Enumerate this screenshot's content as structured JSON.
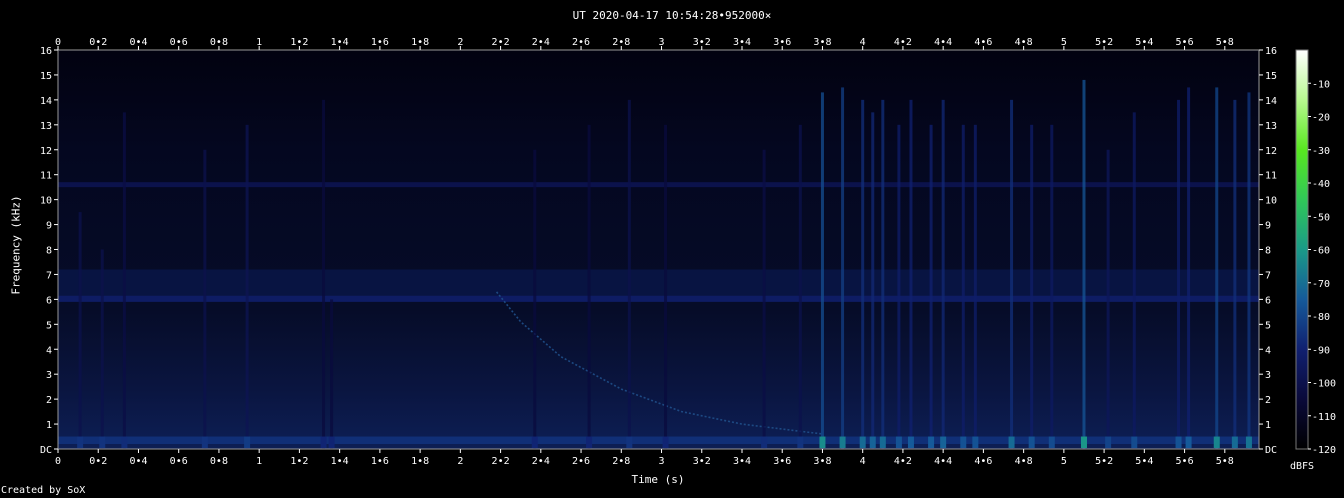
{
  "chart_data": {
    "type": "heatmap",
    "title": "UT 2020-04-17 10:54:28•952000×",
    "xlabel": "Time (s)",
    "ylabel": "Frequency (kHz)",
    "x_range": [
      0,
      5.97
    ],
    "y_range": [
      0,
      16
    ],
    "x_ticks": [
      "0",
      "0•2",
      "0•4",
      "0•6",
      "0•8",
      "1",
      "1•2",
      "1•4",
      "1•6",
      "1•8",
      "2",
      "2•2",
      "2•4",
      "2•6",
      "2•8",
      "3",
      "3•2",
      "3•4",
      "3•6",
      "3•8",
      "4",
      "4•2",
      "4•4",
      "4•6",
      "4•8",
      "5",
      "5•2",
      "5•4",
      "5•6",
      "5•8"
    ],
    "x_tick_values": [
      0,
      0.2,
      0.4,
      0.6,
      0.8,
      1,
      1.2,
      1.4,
      1.6,
      1.8,
      2,
      2.2,
      2.4,
      2.6,
      2.8,
      3,
      3.2,
      3.4,
      3.6,
      3.8,
      4,
      4.2,
      4.4,
      4.6,
      4.8,
      5,
      5.2,
      5.4,
      5.6,
      5.8
    ],
    "y_ticks": [
      "DC",
      "1",
      "2",
      "3",
      "4",
      "5",
      "6",
      "7",
      "8",
      "9",
      "10",
      "11",
      "12",
      "13",
      "14",
      "15",
      "16"
    ],
    "y_tick_values": [
      0,
      1,
      2,
      3,
      4,
      5,
      6,
      7,
      8,
      9,
      10,
      11,
      12,
      13,
      14,
      15,
      16
    ],
    "colorbar": {
      "label": "dBFS",
      "ticks": [
        "-10",
        "-20",
        "-30",
        "-40",
        "-50",
        "-60",
        "-70",
        "-80",
        "-90",
        "-100",
        "-110",
        "-120"
      ],
      "tick_values": [
        -10,
        -20,
        -30,
        -40,
        -50,
        -60,
        -70,
        -80,
        -90,
        -100,
        -110,
        -120
      ],
      "range": [
        -120,
        0
      ],
      "colors": [
        "#000000",
        "#0a0a3a",
        "#102070",
        "#155a9a",
        "#1a9a88",
        "#30c858",
        "#58e820",
        "#b8f890",
        "#ffffff"
      ]
    },
    "bands": [
      {
        "freq_from": 0.2,
        "freq_to": 0.5,
        "level": -85
      },
      {
        "freq_from": 5.9,
        "freq_to": 6.15,
        "level": -90
      },
      {
        "freq_from": 10.5,
        "freq_to": 10.7,
        "level": -98
      }
    ],
    "impulses": [
      {
        "t": 0.11,
        "top": 9.5,
        "level": -100
      },
      {
        "t": 0.22,
        "top": 8,
        "level": -100
      },
      {
        "t": 0.33,
        "top": 13.5,
        "level": -102
      },
      {
        "t": 0.73,
        "top": 12,
        "level": -100
      },
      {
        "t": 0.94,
        "top": 13,
        "level": -98
      },
      {
        "t": 1.32,
        "top": 14,
        "level": -104
      },
      {
        "t": 1.36,
        "top": 6,
        "level": -104
      },
      {
        "t": 2.37,
        "top": 12,
        "level": -104
      },
      {
        "t": 2.64,
        "top": 13,
        "level": -104
      },
      {
        "t": 2.84,
        "top": 14,
        "level": -100
      },
      {
        "t": 3.02,
        "top": 13,
        "level": -104
      },
      {
        "t": 3.51,
        "top": 12,
        "level": -102
      },
      {
        "t": 3.69,
        "top": 13,
        "level": -100
      },
      {
        "t": 3.8,
        "top": 14.3,
        "level": -78
      },
      {
        "t": 3.9,
        "top": 14.5,
        "level": -82
      },
      {
        "t": 4.0,
        "top": 14,
        "level": -86
      },
      {
        "t": 4.05,
        "top": 13.5,
        "level": -88
      },
      {
        "t": 4.1,
        "top": 14,
        "level": -86
      },
      {
        "t": 4.18,
        "top": 13,
        "level": -92
      },
      {
        "t": 4.24,
        "top": 14,
        "level": -90
      },
      {
        "t": 4.34,
        "top": 13,
        "level": -90
      },
      {
        "t": 4.4,
        "top": 14,
        "level": -88
      },
      {
        "t": 4.5,
        "top": 13,
        "level": -92
      },
      {
        "t": 4.56,
        "top": 13,
        "level": -92
      },
      {
        "t": 4.74,
        "top": 14,
        "level": -86
      },
      {
        "t": 4.84,
        "top": 13,
        "level": -92
      },
      {
        "t": 4.94,
        "top": 13,
        "level": -94
      },
      {
        "t": 5.1,
        "top": 14.8,
        "level": -76
      },
      {
        "t": 5.22,
        "top": 12,
        "level": -96
      },
      {
        "t": 5.35,
        "top": 13.5,
        "level": -94
      },
      {
        "t": 5.57,
        "top": 14,
        "level": -92
      },
      {
        "t": 5.62,
        "top": 14.5,
        "level": -90
      },
      {
        "t": 5.76,
        "top": 14.5,
        "level": -80
      },
      {
        "t": 5.85,
        "top": 14,
        "level": -86
      },
      {
        "t": 5.92,
        "top": 14.3,
        "level": -84
      }
    ],
    "chirp": [
      [
        2.18,
        6.3
      ],
      [
        2.3,
        5.1
      ],
      [
        2.5,
        3.7
      ],
      [
        2.8,
        2.4
      ],
      [
        3.1,
        1.5
      ],
      [
        3.4,
        1.0
      ],
      [
        3.8,
        0.6
      ]
    ]
  },
  "title": "UT 2020-04-17 10:54:28•952000×",
  "xlabel": "Time (s)",
  "ylabel": "Frequency (kHz)",
  "colorbar_label": "dBFS",
  "credit": "Created by SoX"
}
